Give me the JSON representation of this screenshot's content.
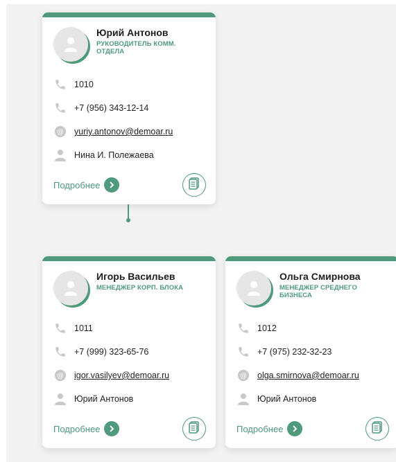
{
  "cards": [
    {
      "name": "Юрий Антонов",
      "role": "РУКОВОДИТЕЛЬ КОММ. ОТДЕЛА",
      "ext": "1010",
      "phone": "+7 (956) 343-12-14",
      "email": "yuriy.antonov@demoar.ru",
      "manager": "Нина И. Полежаева",
      "more_label": "Подробнее"
    },
    {
      "name": "Игорь Васильев",
      "role": "МЕНЕДЖЕР КОРП. БЛОКА",
      "ext": "1011",
      "phone": "+7 (999) 323-65-76",
      "email": "igor.vasilyev@demoar.ru",
      "manager": "Юрий Антонов",
      "more_label": "Подробнее"
    },
    {
      "name": "Ольга Смирнова",
      "role": "МЕНЕДЖЕР СРЕДНЕГО БИЗНЕСА",
      "ext": "1012",
      "phone": "+7 (975) 232-32-23",
      "email": "olga.smirnova@demoar.ru",
      "manager": "Юрий Антонов",
      "more_label": "Подробнее"
    }
  ],
  "colors": {
    "accent": "#4e9a7b",
    "icon": "#c8c8c8",
    "background": "#f2f2f2"
  },
  "icons": {
    "ext": "phone-icon",
    "phone": "phone-icon",
    "email": "at-sign-icon",
    "manager": "person-icon",
    "more": "chevron-right-icon",
    "doc": "document-icon"
  }
}
